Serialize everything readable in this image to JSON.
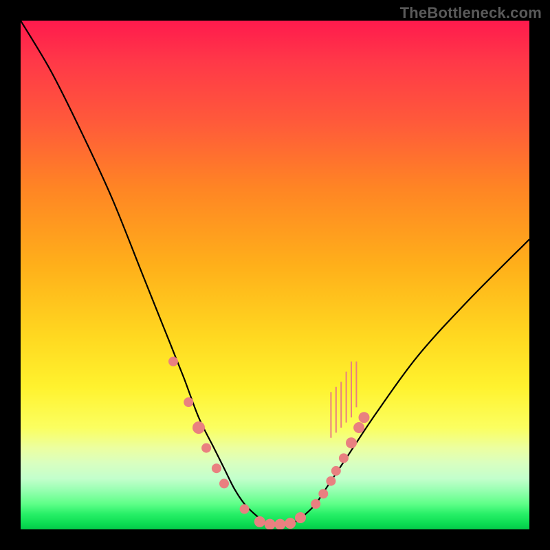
{
  "watermark": "TheBottleneck.com",
  "colors": {
    "frame": "#000000",
    "curve": "#000000",
    "marker": "#e98080",
    "gradient_top": "#ff1a4d",
    "gradient_bottom": "#05c849"
  },
  "chart_data": {
    "type": "line",
    "title": "",
    "xlabel": "",
    "ylabel": "",
    "xlim": [
      0,
      100
    ],
    "ylim": [
      0,
      100
    ],
    "x": [
      0,
      6,
      12,
      18,
      24,
      28,
      32,
      35,
      38,
      40,
      42,
      44,
      46,
      48,
      50,
      52,
      54,
      56,
      58,
      60,
      64,
      70,
      78,
      88,
      100
    ],
    "y": [
      100,
      90,
      78,
      65,
      50,
      40,
      30,
      22,
      16,
      12,
      8,
      5,
      3,
      1.5,
      1,
      1,
      1.5,
      3,
      5,
      8,
      14,
      23,
      34,
      45,
      57
    ],
    "series": [
      {
        "name": "bottleneck-curve",
        "x": [
          0,
          6,
          12,
          18,
          24,
          28,
          32,
          35,
          38,
          40,
          42,
          44,
          46,
          48,
          50,
          52,
          54,
          56,
          58,
          60,
          64,
          70,
          78,
          88,
          100
        ],
        "y": [
          100,
          90,
          78,
          65,
          50,
          40,
          30,
          22,
          16,
          12,
          8,
          5,
          3,
          1.5,
          1,
          1,
          1.5,
          3,
          5,
          8,
          14,
          23,
          34,
          45,
          57
        ]
      }
    ],
    "markers": [
      {
        "x": 30,
        "y": 33,
        "r": 7
      },
      {
        "x": 33,
        "y": 25,
        "r": 7
      },
      {
        "x": 35,
        "y": 20,
        "r": 9
      },
      {
        "x": 36.5,
        "y": 16,
        "r": 7
      },
      {
        "x": 38.5,
        "y": 12,
        "r": 7
      },
      {
        "x": 40,
        "y": 9,
        "r": 7
      },
      {
        "x": 44,
        "y": 4,
        "r": 7
      },
      {
        "x": 47,
        "y": 1.5,
        "r": 8
      },
      {
        "x": 49,
        "y": 1,
        "r": 8
      },
      {
        "x": 51,
        "y": 1,
        "r": 8
      },
      {
        "x": 53,
        "y": 1.2,
        "r": 8
      },
      {
        "x": 55,
        "y": 2.3,
        "r": 8
      },
      {
        "x": 58,
        "y": 5,
        "r": 7
      },
      {
        "x": 59.5,
        "y": 7,
        "r": 7
      },
      {
        "x": 61,
        "y": 9.5,
        "r": 7
      },
      {
        "x": 62,
        "y": 11.5,
        "r": 7
      },
      {
        "x": 63.5,
        "y": 14,
        "r": 7
      },
      {
        "x": 65,
        "y": 17,
        "r": 8
      },
      {
        "x": 66.5,
        "y": 20,
        "r": 8
      },
      {
        "x": 67.5,
        "y": 22,
        "r": 8
      }
    ],
    "whiskers": [
      {
        "x": 61,
        "y0": 18,
        "y1": 27
      },
      {
        "x": 62,
        "y0": 19,
        "y1": 28
      },
      {
        "x": 63,
        "y0": 20,
        "y1": 29
      },
      {
        "x": 64,
        "y0": 21,
        "y1": 31
      },
      {
        "x": 65,
        "y0": 22,
        "y1": 33
      },
      {
        "x": 66,
        "y0": 24,
        "y1": 33
      }
    ]
  }
}
